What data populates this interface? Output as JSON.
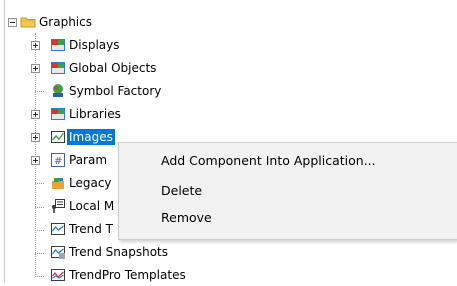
{
  "tree": {
    "root": {
      "label": "Graphics",
      "icon": "folder-icon",
      "expanded": true
    },
    "items": [
      {
        "label": "Displays",
        "icon": "displays-icon",
        "has_toggle": true,
        "selected": false
      },
      {
        "label": "Global Objects",
        "icon": "global-objects-icon",
        "has_toggle": true,
        "selected": false
      },
      {
        "label": "Symbol Factory",
        "icon": "symbol-factory-icon",
        "has_toggle": false,
        "selected": false
      },
      {
        "label": "Libraries",
        "icon": "libraries-icon",
        "has_toggle": true,
        "selected": false
      },
      {
        "label": "Images",
        "icon": "images-icon",
        "has_toggle": true,
        "selected": true
      },
      {
        "label": "Param",
        "icon": "parameters-icon",
        "has_toggle": true,
        "selected": false
      },
      {
        "label": "Legacy",
        "icon": "legacy-icon",
        "has_toggle": false,
        "selected": false
      },
      {
        "label": "Local M",
        "icon": "local-messages-icon",
        "has_toggle": false,
        "selected": false
      },
      {
        "label": "Trend T",
        "icon": "trend-templates-icon",
        "has_toggle": false,
        "selected": false
      },
      {
        "label": "Trend Snapshots",
        "icon": "trend-snapshots-icon",
        "has_toggle": false,
        "selected": false
      },
      {
        "label": "TrendPro Templates",
        "icon": "trendpro-templates-icon",
        "has_toggle": false,
        "selected": false
      }
    ]
  },
  "context_menu": {
    "items": [
      {
        "label": "Add Component Into Application..."
      },
      {
        "label": "Delete"
      },
      {
        "label": "Remove"
      }
    ]
  },
  "colors": {
    "selection": "#0078d7",
    "menu_bg": "#f2f2f2",
    "menu_border": "#cccccc"
  }
}
